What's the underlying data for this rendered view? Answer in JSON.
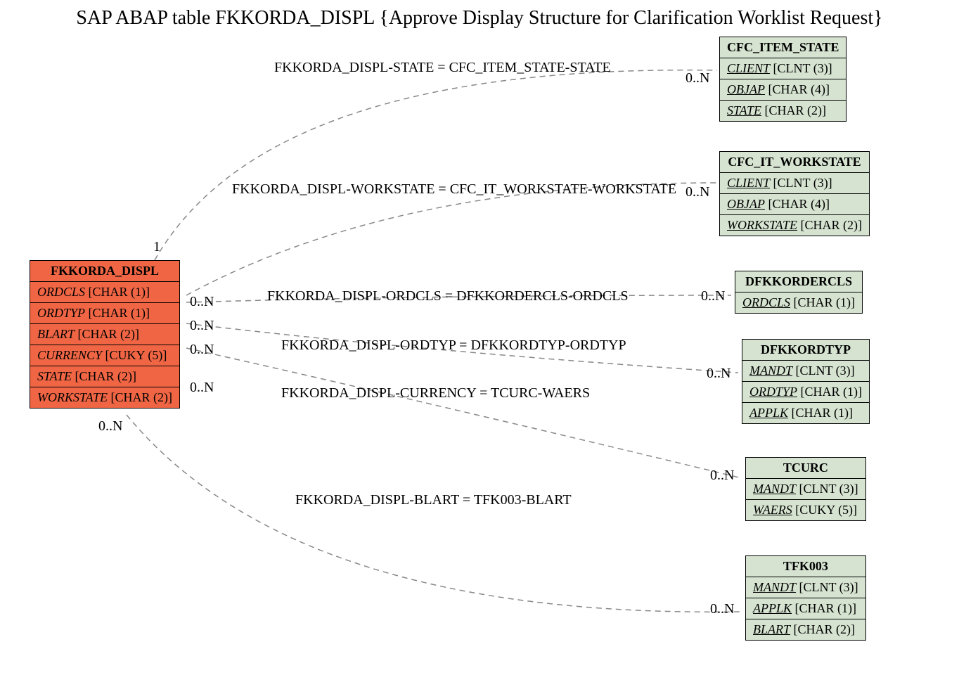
{
  "title": "SAP ABAP table FKKORDA_DISPL {Approve Display Structure for Clarification Worklist Request}",
  "main": {
    "name": "FKKORDA_DISPL",
    "fields": [
      {
        "name": "ORDCLS",
        "type": "[CHAR (1)]"
      },
      {
        "name": "ORDTYP",
        "type": "[CHAR (1)]"
      },
      {
        "name": "BLART",
        "type": "[CHAR (2)]"
      },
      {
        "name": "CURRENCY",
        "type": "[CUKY (5)]"
      },
      {
        "name": "STATE",
        "type": "[CHAR (2)]"
      },
      {
        "name": "WORKSTATE",
        "type": "[CHAR (2)]"
      }
    ]
  },
  "targets": [
    {
      "name": "CFC_ITEM_STATE",
      "fields": [
        {
          "name": "CLIENT",
          "type": "[CLNT (3)]",
          "key": true
        },
        {
          "name": "OBJAP",
          "type": "[CHAR (4)]",
          "key": true
        },
        {
          "name": "STATE",
          "type": "[CHAR (2)]",
          "key": true
        }
      ]
    },
    {
      "name": "CFC_IT_WORKSTATE",
      "fields": [
        {
          "name": "CLIENT",
          "type": "[CLNT (3)]",
          "key": true
        },
        {
          "name": "OBJAP",
          "type": "[CHAR (4)]",
          "key": true
        },
        {
          "name": "WORKSTATE",
          "type": "[CHAR (2)]",
          "key": true
        }
      ]
    },
    {
      "name": "DFKKORDERCLS",
      "fields": [
        {
          "name": "ORDCLS",
          "type": "[CHAR (1)]",
          "key": true
        }
      ]
    },
    {
      "name": "DFKKORDTYP",
      "fields": [
        {
          "name": "MANDT",
          "type": "[CLNT (3)]",
          "key": true
        },
        {
          "name": "ORDTYP",
          "type": "[CHAR (1)]",
          "key": true
        },
        {
          "name": "APPLK",
          "type": "[CHAR (1)]",
          "key": true
        }
      ]
    },
    {
      "name": "TCURC",
      "fields": [
        {
          "name": "MANDT",
          "type": "[CLNT (3)]",
          "key": true
        },
        {
          "name": "WAERS",
          "type": "[CUKY (5)]",
          "key": true
        }
      ]
    },
    {
      "name": "TFK003",
      "fields": [
        {
          "name": "MANDT",
          "type": "[CLNT (3)]",
          "key": true
        },
        {
          "name": "APPLK",
          "type": "[CHAR (1)]",
          "key": true
        },
        {
          "name": "BLART",
          "type": "[CHAR (2)]",
          "key": true
        }
      ]
    }
  ],
  "relations": [
    {
      "label": "FKKORDA_DISPL-STATE = CFC_ITEM_STATE-STATE"
    },
    {
      "label": "FKKORDA_DISPL-WORKSTATE = CFC_IT_WORKSTATE-WORKSTATE"
    },
    {
      "label": "FKKORDA_DISPL-ORDCLS = DFKKORDERCLS-ORDCLS"
    },
    {
      "label": "FKKORDA_DISPL-ORDTYP = DFKKORDTYP-ORDTYP"
    },
    {
      "label": "FKKORDA_DISPL-CURRENCY = TCURC-WAERS"
    },
    {
      "label": "FKKORDA_DISPL-BLART = TFK003-BLART"
    }
  ],
  "cards": {
    "one": "1",
    "zn": "0..N"
  }
}
